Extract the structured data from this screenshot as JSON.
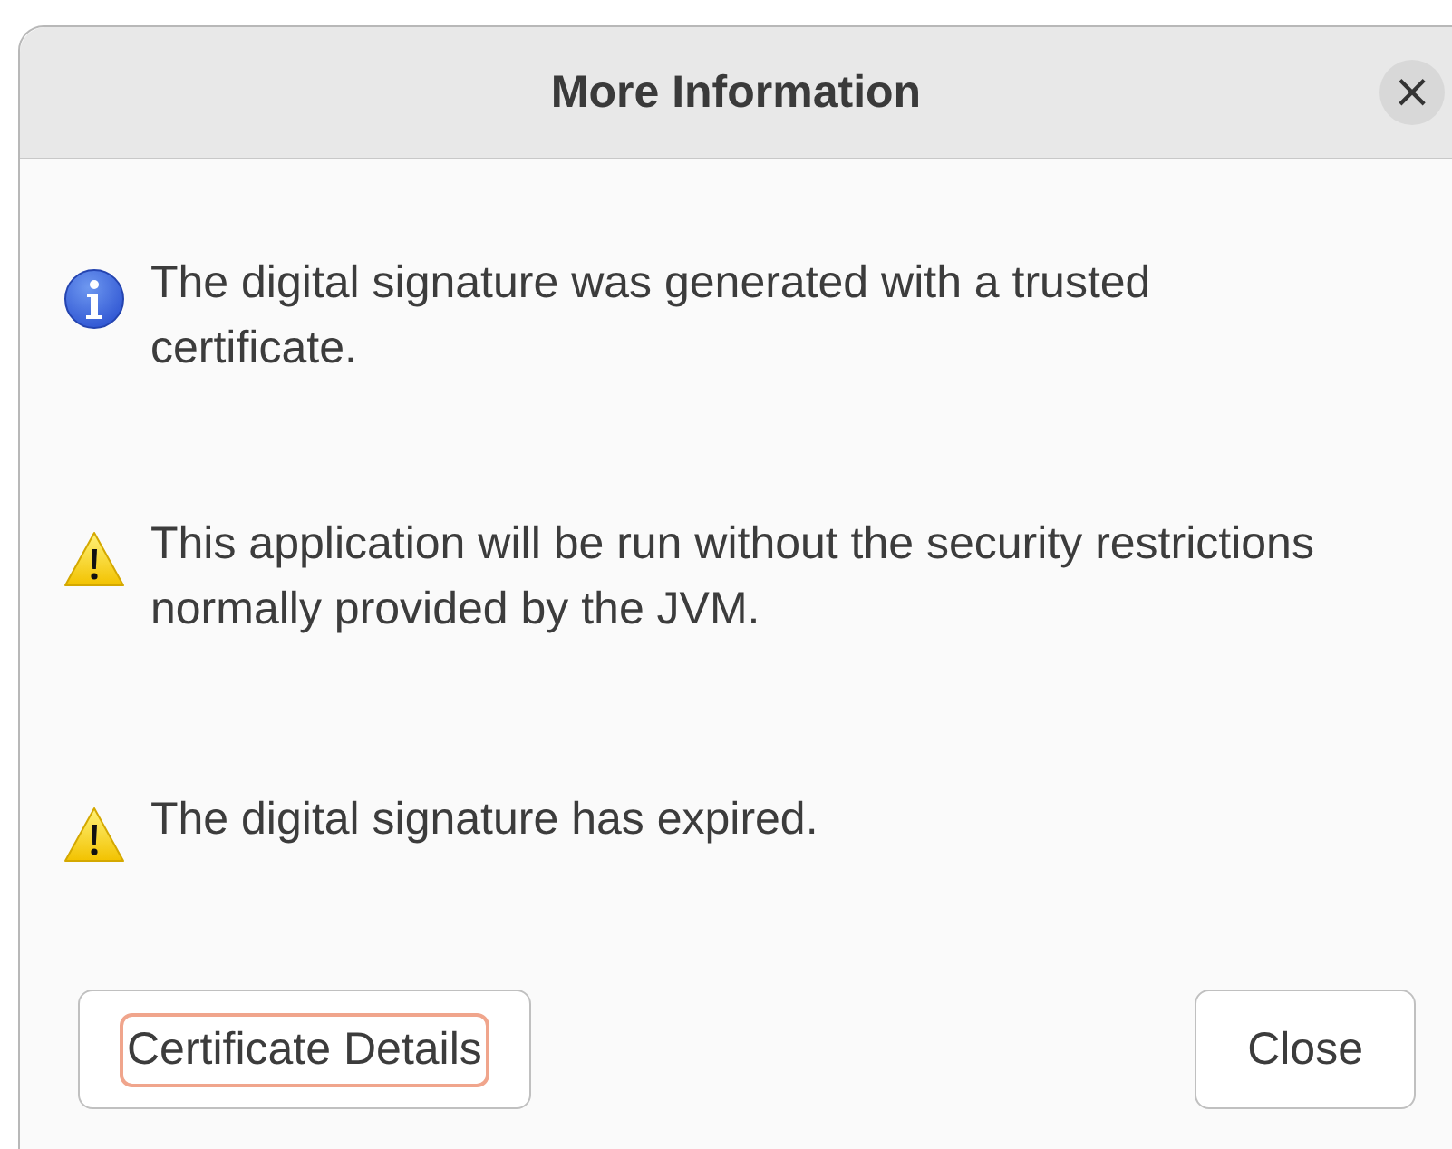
{
  "window": {
    "title": "More Information",
    "close_symbol": "×"
  },
  "messages": [
    {
      "kind": "info",
      "text": "The digital signature was generated with a trusted certificate."
    },
    {
      "kind": "warning",
      "text": "This application will be run without the security restrictions normally provided by the JVM."
    },
    {
      "kind": "warning",
      "text": "The digital signature has expired."
    }
  ],
  "buttons": [
    {
      "label": "Certificate Details",
      "focused": true
    },
    {
      "label": "Close",
      "focused": false
    }
  ]
}
